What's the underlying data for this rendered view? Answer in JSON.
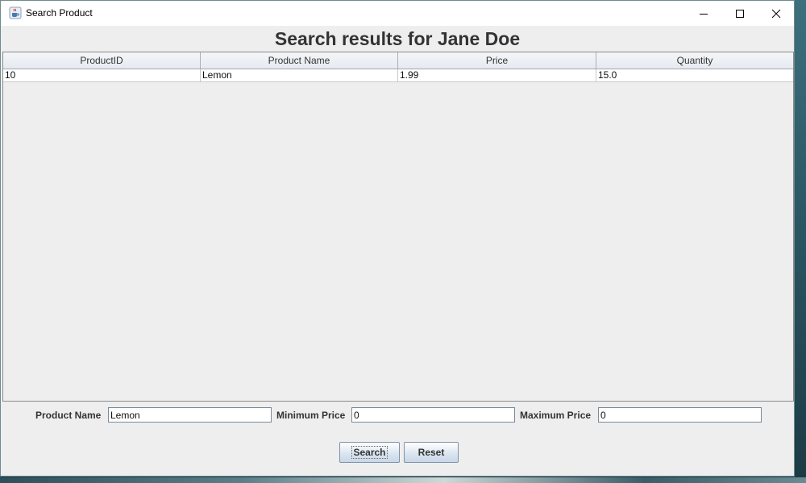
{
  "window": {
    "title": "Search Product"
  },
  "heading": "Search results for Jane Doe",
  "table": {
    "columns": [
      "ProductID",
      "Product Name",
      "Price",
      "Quantity"
    ],
    "rows": [
      [
        "10",
        "Lemon",
        "1.99",
        "15.0"
      ]
    ]
  },
  "form": {
    "product_name_label": "Product Name",
    "product_name_value": "Lemon",
    "min_price_label": "Minimum Price",
    "min_price_value": "0",
    "max_price_label": "Maximum Price",
    "max_price_value": "0"
  },
  "buttons": {
    "search": "Search",
    "reset": "Reset"
  },
  "icons": {
    "app": "java-cup-icon",
    "minimize": "minimize-icon",
    "maximize": "maximize-icon",
    "close": "close-icon"
  }
}
